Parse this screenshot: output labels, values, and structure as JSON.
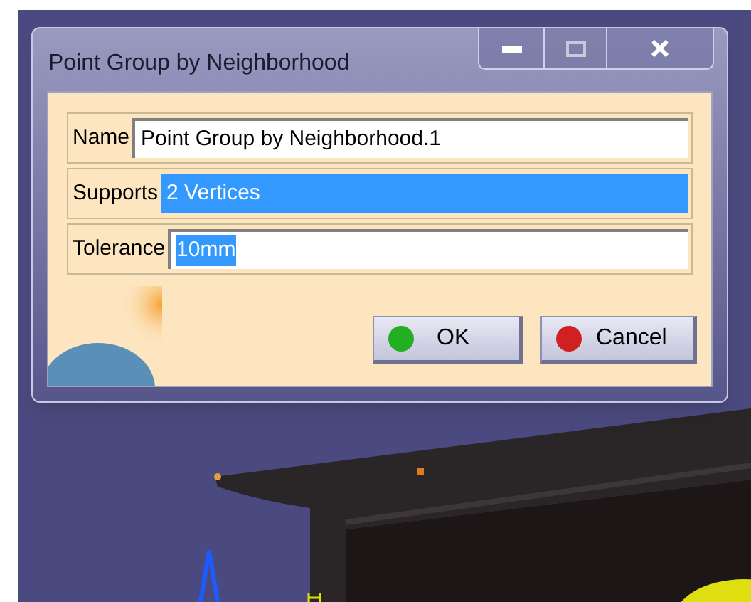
{
  "window": {
    "title": "Point Group by Neighborhood"
  },
  "fields": [
    {
      "label": "Name",
      "value": "Point Group by Neighborhood.1",
      "kind": "text",
      "selected": false
    },
    {
      "label": "Supports",
      "value": "2 Vertices",
      "kind": "list",
      "selected": true
    },
    {
      "label": "Tolerance",
      "value": "10mm",
      "kind": "text",
      "selected": true
    }
  ],
  "buttons": [
    {
      "label": "OK",
      "color": "#22b022"
    },
    {
      "label": "Cancel",
      "color": "#d02020"
    }
  ]
}
